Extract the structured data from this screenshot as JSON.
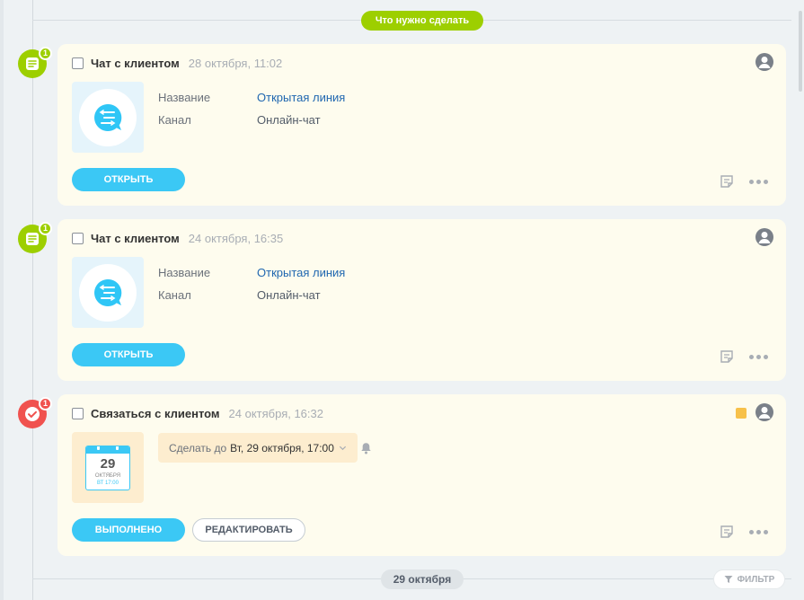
{
  "timeline": {
    "todo_label": "Что нужно сделать",
    "date_label": "29 октября",
    "filter_label": "ФИЛЬТР"
  },
  "cards": [
    {
      "badge": "1",
      "title": "Чат с клиентом",
      "time": "28 октября, 11:02",
      "fields": [
        {
          "label": "Название",
          "value": "Открытая линия"
        },
        {
          "label": "Канал",
          "value": "Онлайн-чат"
        }
      ],
      "primary_button": "ОТКРЫТЬ"
    },
    {
      "badge": "1",
      "title": "Чат с клиентом",
      "time": "24 октября, 16:35",
      "fields": [
        {
          "label": "Название",
          "value": "Открытая линия"
        },
        {
          "label": "Канал",
          "value": "Онлайн-чат"
        }
      ],
      "primary_button": "ОТКРЫТЬ"
    },
    {
      "badge": "1",
      "title": "Связаться с клиентом",
      "time": "24 октября, 16:32",
      "deadline_prefix": "Сделать до",
      "deadline_value": "Вт, 29 октября, 17:00",
      "calendar": {
        "day": "29",
        "month": "ОКТЯБРЯ",
        "time": "ВТ 17:00"
      },
      "primary_button": "ВЫПОЛНЕНО",
      "secondary_button": "РЕДАКТИРОВАТЬ"
    }
  ],
  "colors": {
    "accent_green": "#9dcf00",
    "accent_red": "#f0524f",
    "button_blue": "#3bc8f5",
    "link_blue": "#2067b0",
    "card_bg": "#fefcee"
  }
}
